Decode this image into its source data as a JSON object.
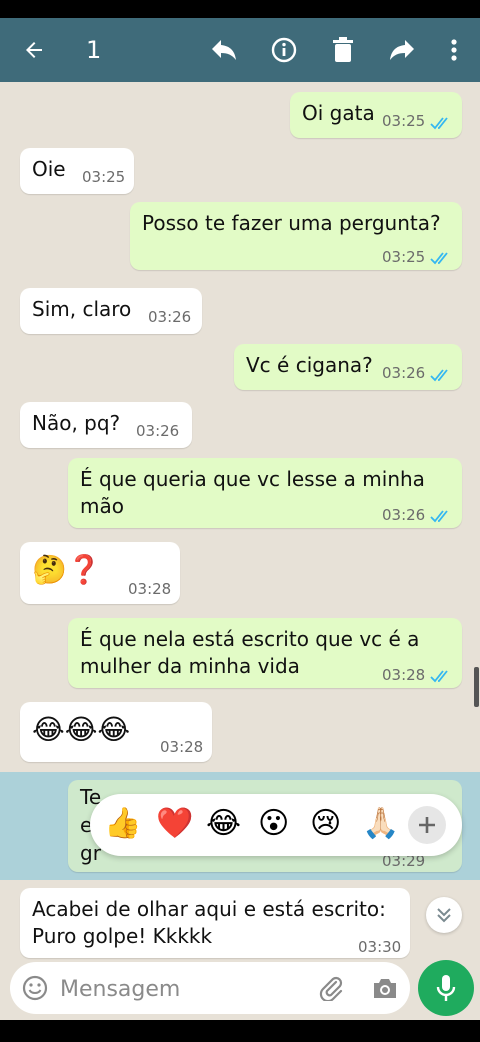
{
  "header": {
    "selected_count": "1"
  },
  "messages": [
    {
      "direction": "out",
      "text": "Oi gata",
      "time": "03:25"
    },
    {
      "direction": "in",
      "text": "Oie",
      "time": "03:25"
    },
    {
      "direction": "out",
      "text": "Posso te fazer uma pergunta?",
      "time": "03:25"
    },
    {
      "direction": "in",
      "text": "Sim, claro",
      "time": "03:26"
    },
    {
      "direction": "out",
      "text": "Vc é cigana?",
      "time": "03:26"
    },
    {
      "direction": "in",
      "text": "Não, pq?",
      "time": "03:26"
    },
    {
      "direction": "out",
      "text": "É que queria que vc lesse a minha\nmão",
      "time": "03:26"
    },
    {
      "direction": "in",
      "text": "🤔❓",
      "time": "03:28"
    },
    {
      "direction": "out",
      "text": "É que nela está escrito que vc é a\nmulher da minha vida",
      "time": "03:28"
    },
    {
      "direction": "in",
      "text": "😂😂😂",
      "time": "03:28"
    },
    {
      "direction": "out",
      "text": "Te",
      "text2": "e",
      "text3": "gr",
      "time": "03:29",
      "selected": true
    },
    {
      "direction": "in",
      "text": "Acabei de olhar aqui e está escrito:\nPuro golpe! Kkkkk",
      "time": "03:30"
    }
  ],
  "reactions": [
    "👍",
    "❤️",
    "😂",
    "😮",
    "😢",
    "🙏🏻"
  ],
  "composer": {
    "placeholder": "Mensagem"
  },
  "colors": {
    "header": "#3f6b7a",
    "outgoing": "#e2fbc6",
    "incoming": "#ffffff",
    "read_ticks": "#34b7f1",
    "mic": "#1fab5e"
  }
}
